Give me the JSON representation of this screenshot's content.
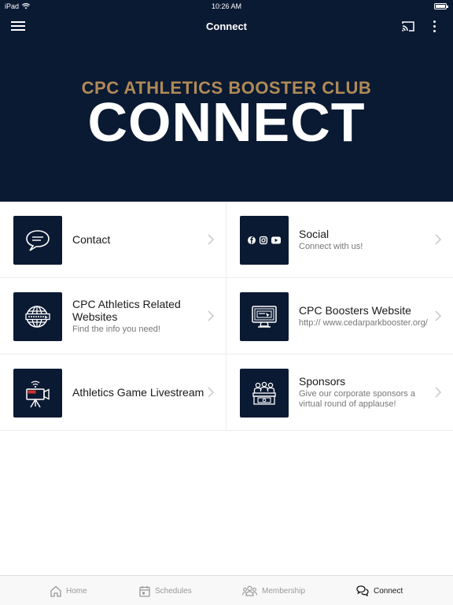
{
  "status_bar": {
    "device": "iPad",
    "time": "10:26 AM"
  },
  "nav": {
    "title": "Connect"
  },
  "hero": {
    "subtitle": "CPC ATHLETICS BOOSTER CLUB",
    "title": "CONNECT"
  },
  "items": [
    {
      "title": "Contact",
      "subtitle": "",
      "icon": "chat-bubble-icon"
    },
    {
      "title": "Social",
      "subtitle": "Connect with us!",
      "icon": "social-media-icon"
    },
    {
      "title": "CPC Athletics Related Websites",
      "subtitle": "Find the info you need!",
      "icon": "globe-icon"
    },
    {
      "title": "CPC Boosters Website",
      "subtitle": "http:// www.cedarparkbooster.org/",
      "icon": "computer-monitor-icon"
    },
    {
      "title": "Athletics Game Livestream",
      "subtitle": "",
      "icon": "livestream-camera-icon"
    },
    {
      "title": "Sponsors",
      "subtitle": "Give our corporate sponsors a virtual round of applause!",
      "icon": "sponsors-stage-icon"
    }
  ],
  "tabs": [
    {
      "label": "Home",
      "icon": "home-icon"
    },
    {
      "label": "Schedules",
      "icon": "calendar-icon"
    },
    {
      "label": "Membership",
      "icon": "people-icon"
    },
    {
      "label": "Connect",
      "icon": "chat-bubbles-icon",
      "active": true
    }
  ],
  "colors": {
    "navy": "#0b1a33",
    "gold": "#b08a56",
    "text": "#1a1a1a",
    "muted": "#777777",
    "tab_inactive": "#999999"
  }
}
